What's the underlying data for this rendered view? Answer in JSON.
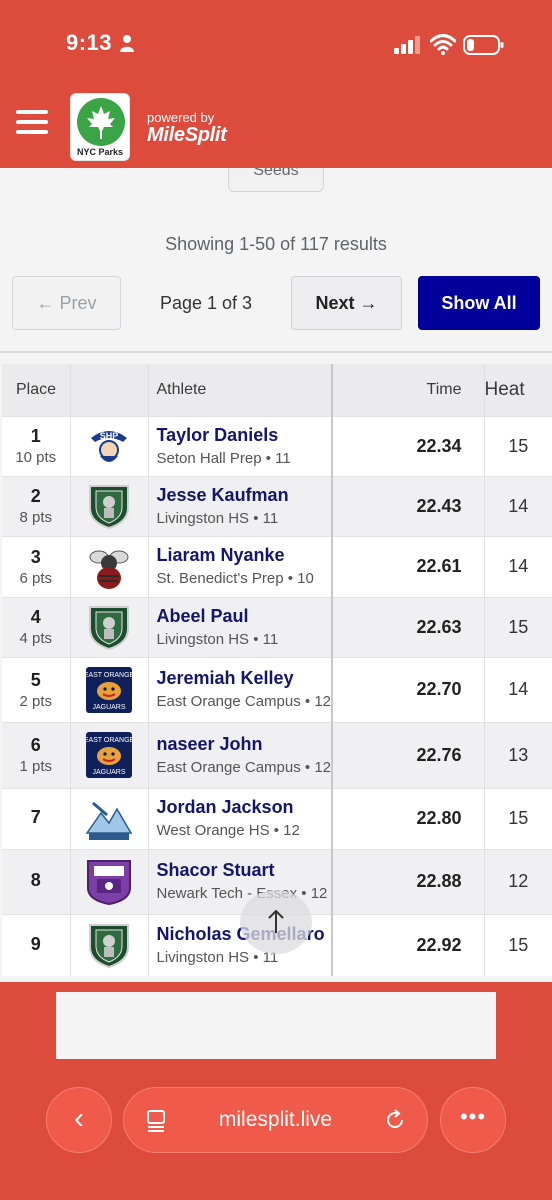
{
  "status_bar": {
    "time": "9:13"
  },
  "header": {
    "parks_label": "NYC Parks",
    "powered_by": "powered by",
    "brand": "MileSplit"
  },
  "seeds_label": "Seeds",
  "results_summary": "Showing 1-50 of 117 results",
  "pagination": {
    "prev_label": "← Prev",
    "page_indicator": "Page 1 of 3",
    "next_label": "Next →",
    "show_all_label": "Show All"
  },
  "table": {
    "headers": {
      "place": "Place",
      "athlete": "Athlete",
      "time": "Time",
      "heat": "Heat"
    },
    "rows": [
      {
        "place": "1",
        "pts": "10 pts",
        "name": "Taylor Daniels",
        "team": "Seton Hall Prep • 11",
        "time": "22.34",
        "heat": "15",
        "logo": "seton-hall-pirate-logo"
      },
      {
        "place": "2",
        "pts": "8 pts",
        "name": "Jesse Kaufman",
        "team": "Livingston HS • 11",
        "time": "22.43",
        "heat": "14",
        "logo": "livingston-lancer-shield-logo"
      },
      {
        "place": "3",
        "pts": "6 pts",
        "name": "Liaram Nyanke",
        "team": "St. Benedict's Prep • 10",
        "time": "22.61",
        "heat": "14",
        "logo": "st-benedicts-gray-bee-logo"
      },
      {
        "place": "4",
        "pts": "4 pts",
        "name": "Abeel Paul",
        "team": "Livingston HS • 11",
        "time": "22.63",
        "heat": "15",
        "logo": "livingston-lancer-shield-logo"
      },
      {
        "place": "5",
        "pts": "2 pts",
        "name": "Jeremiah Kelley",
        "team": "East Orange Campus • 12",
        "time": "22.70",
        "heat": "14",
        "logo": "east-orange-jaguars-logo"
      },
      {
        "place": "6",
        "pts": "1 pts",
        "name": "naseer John",
        "team": "East Orange Campus • 12",
        "time": "22.76",
        "heat": "13",
        "logo": "east-orange-jaguars-logo"
      },
      {
        "place": "7",
        "pts": "",
        "name": "Jordan Jackson",
        "team": "West Orange HS • 12",
        "time": "22.80",
        "heat": "15",
        "logo": "west-orange-mountaineers-logo"
      },
      {
        "place": "8",
        "pts": "",
        "name": "Shacor Stuart",
        "team": "Newark Tech - Essex • 12",
        "time": "22.88",
        "heat": "12",
        "logo": "essex-county-newark-tech-logo"
      },
      {
        "place": "9",
        "pts": "",
        "name": "Nicholas Gemellaro",
        "team": "Livingston HS • 11",
        "time": "22.92",
        "heat": "15",
        "logo": "livingston-lancer-shield-logo"
      }
    ]
  },
  "browser": {
    "url": "milesplit.live",
    "back_symbol": "‹",
    "more_symbol": "•••"
  },
  "colors": {
    "brand_red": "#dd4b3c",
    "navy": "#00009b",
    "name_blue": "#15156b"
  }
}
